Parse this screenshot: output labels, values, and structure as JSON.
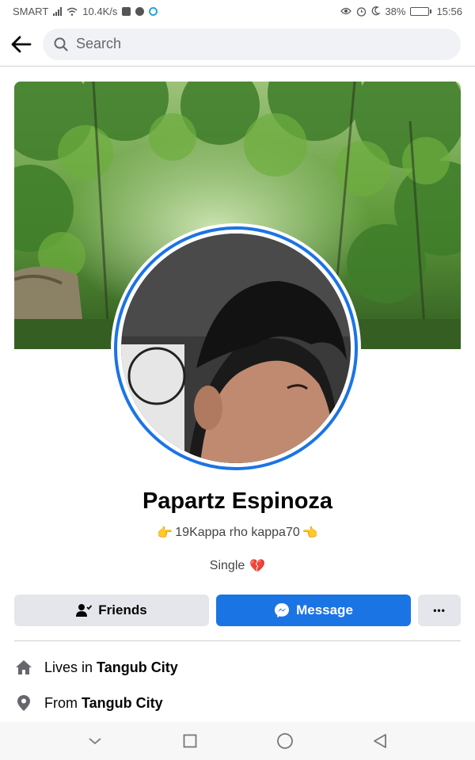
{
  "status_bar": {
    "carrier": "SMART",
    "speed": "10.4K/s",
    "battery_percent": "38%",
    "battery_level": 0.38,
    "time": "15:56"
  },
  "search": {
    "placeholder": "Search"
  },
  "profile": {
    "name": "Papartz Espinoza",
    "bio_text": "19Kappa rho kappa70",
    "bio_left_emoji": "👉",
    "bio_right_emoji": "👈",
    "relationship": "Single",
    "relationship_emoji": "💔"
  },
  "actions": {
    "friends_label": "Friends",
    "message_label": "Message",
    "more_label": "•••"
  },
  "details": {
    "lives_prefix": "Lives in ",
    "lives_city": "Tangub City",
    "from_prefix": "From ",
    "from_city": "Tangub City"
  },
  "colors": {
    "accent": "#1b74e4",
    "button_gray": "#e4e6eb",
    "text": "#050505"
  },
  "icons": [
    "back-arrow-icon",
    "search-icon",
    "friends-person-icon",
    "messenger-icon",
    "home-icon",
    "location-pin-icon",
    "nav-back-icon",
    "nav-home-icon",
    "nav-recents-icon",
    "nav-collapse-icon"
  ]
}
